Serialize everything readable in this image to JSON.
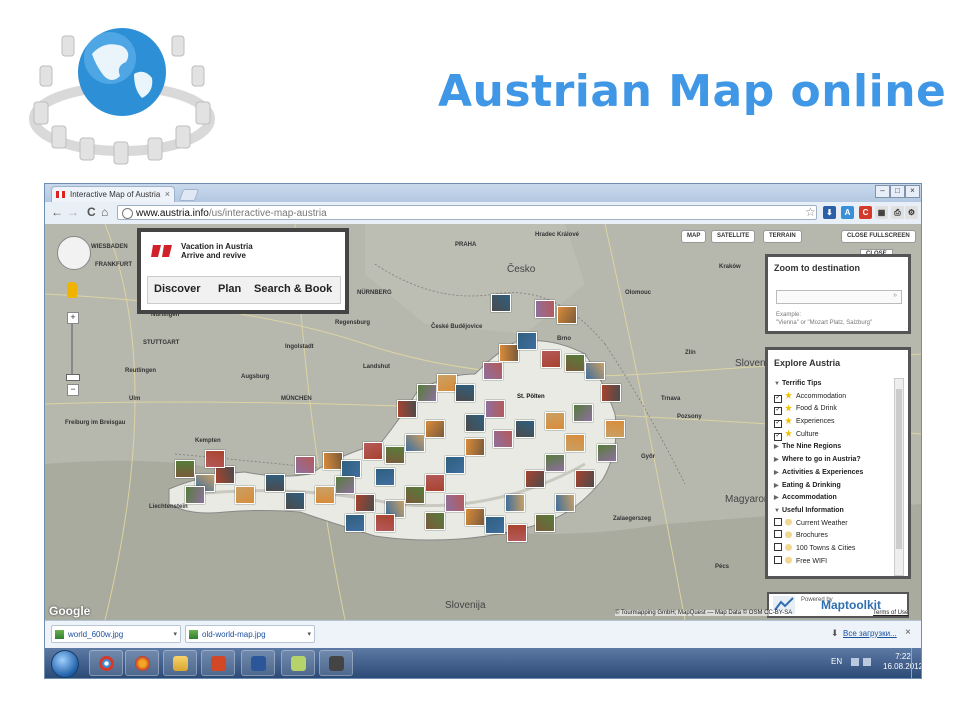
{
  "slide": {
    "title": "Austrian Map online"
  },
  "browser": {
    "tab_title": "Interactive Map of Austria",
    "tab_close": "×",
    "url_host": "www.austria.info",
    "url_path": "/us/interactive-map-austria",
    "back": "←",
    "forward": "→",
    "reload": "C",
    "home": "⌂",
    "star": "☆",
    "wrench": "🔧"
  },
  "map": {
    "pan_label": "",
    "zoom_in": "+",
    "zoom_out": "−",
    "types": [
      "MAP",
      "SATELLITE",
      "TERRAIN"
    ],
    "close_fullscreen": "CLOSE FULLSCREEN",
    "close": "CLOSE",
    "google": "Google",
    "attribution": "© Tourmapping GmbH; MapQuest — Map Data © OSM CC-BY-SA",
    "terms": "Terms of Use",
    "labels": {
      "countries": [
        "Česko",
        "Slovensko",
        "Magyarország",
        "Slovenija"
      ],
      "cities": [
        "WIESBADEN",
        "FRANKFURT",
        "NÜRNBERG",
        "PRAHA",
        "STUTTGART",
        "Ingolstadt",
        "Regensburg",
        "MÜNCHEN",
        "Augsburg",
        "Ulm",
        "Reutlingen",
        "Freiburg im Breisgau",
        "České Budějovice",
        "St. Pölten",
        "Brno",
        "Kraków",
        "Hradec Králové",
        "Olomouc",
        "Zlín",
        "Trnava",
        "Győr",
        "Zalaegerszeg",
        "Pécs",
        "Pozsony",
        "Nürtingen",
        "Landshut",
        "Kempten",
        "Liechtenstein"
      ]
    }
  },
  "brand": {
    "line1": "Vacation in Austria",
    "line2": "Arrive and revive",
    "nav": [
      "Discover",
      "Plan",
      "Search & Book"
    ]
  },
  "zoom_panel": {
    "title": "Zoom to destination",
    "input_value": "",
    "go": "»",
    "example_line1": "Example:",
    "example_line2": "\"Vienna\" or \"Mozart Platz, Salzburg\""
  },
  "explore": {
    "title": "Explore Austria",
    "items": [
      {
        "label": "Terrific Tips",
        "kind": "group-open"
      },
      {
        "label": "Accommodation",
        "kind": "check",
        "checked": true
      },
      {
        "label": "Food & Drink",
        "kind": "check",
        "checked": true
      },
      {
        "label": "Experiences",
        "kind": "check",
        "checked": true
      },
      {
        "label": "Culture",
        "kind": "check",
        "checked": true
      },
      {
        "label": "The Nine Regions",
        "kind": "group-closed"
      },
      {
        "label": "Where to go in Austria?",
        "kind": "group-closed"
      },
      {
        "label": "Activities & Experiences",
        "kind": "group-closed"
      },
      {
        "label": "Eating & Drinking",
        "kind": "group-closed"
      },
      {
        "label": "Accommodation",
        "kind": "group-closed"
      },
      {
        "label": "Useful Information",
        "kind": "group-open"
      },
      {
        "label": "Current Weather",
        "kind": "check",
        "checked": false
      },
      {
        "label": "Brochures",
        "kind": "check",
        "checked": false
      },
      {
        "label": "100 Towns & Cities",
        "kind": "check",
        "checked": false
      },
      {
        "label": "Free WIFI",
        "kind": "check",
        "checked": false
      }
    ]
  },
  "maptoolkit": {
    "powered": "Powered by",
    "name": "Maptoolkit"
  },
  "downloads": {
    "items": [
      "world_600w.jpg",
      "old-world-map.jpg"
    ],
    "all": "Все загрузки...",
    "close": "×"
  },
  "taskbar": {
    "lang": "EN",
    "time": "7:22",
    "date": "16.08.2012"
  },
  "colors": {
    "title": "#3f97e6",
    "brand_red": "#d0212a",
    "tip_star": "#f2c200"
  }
}
